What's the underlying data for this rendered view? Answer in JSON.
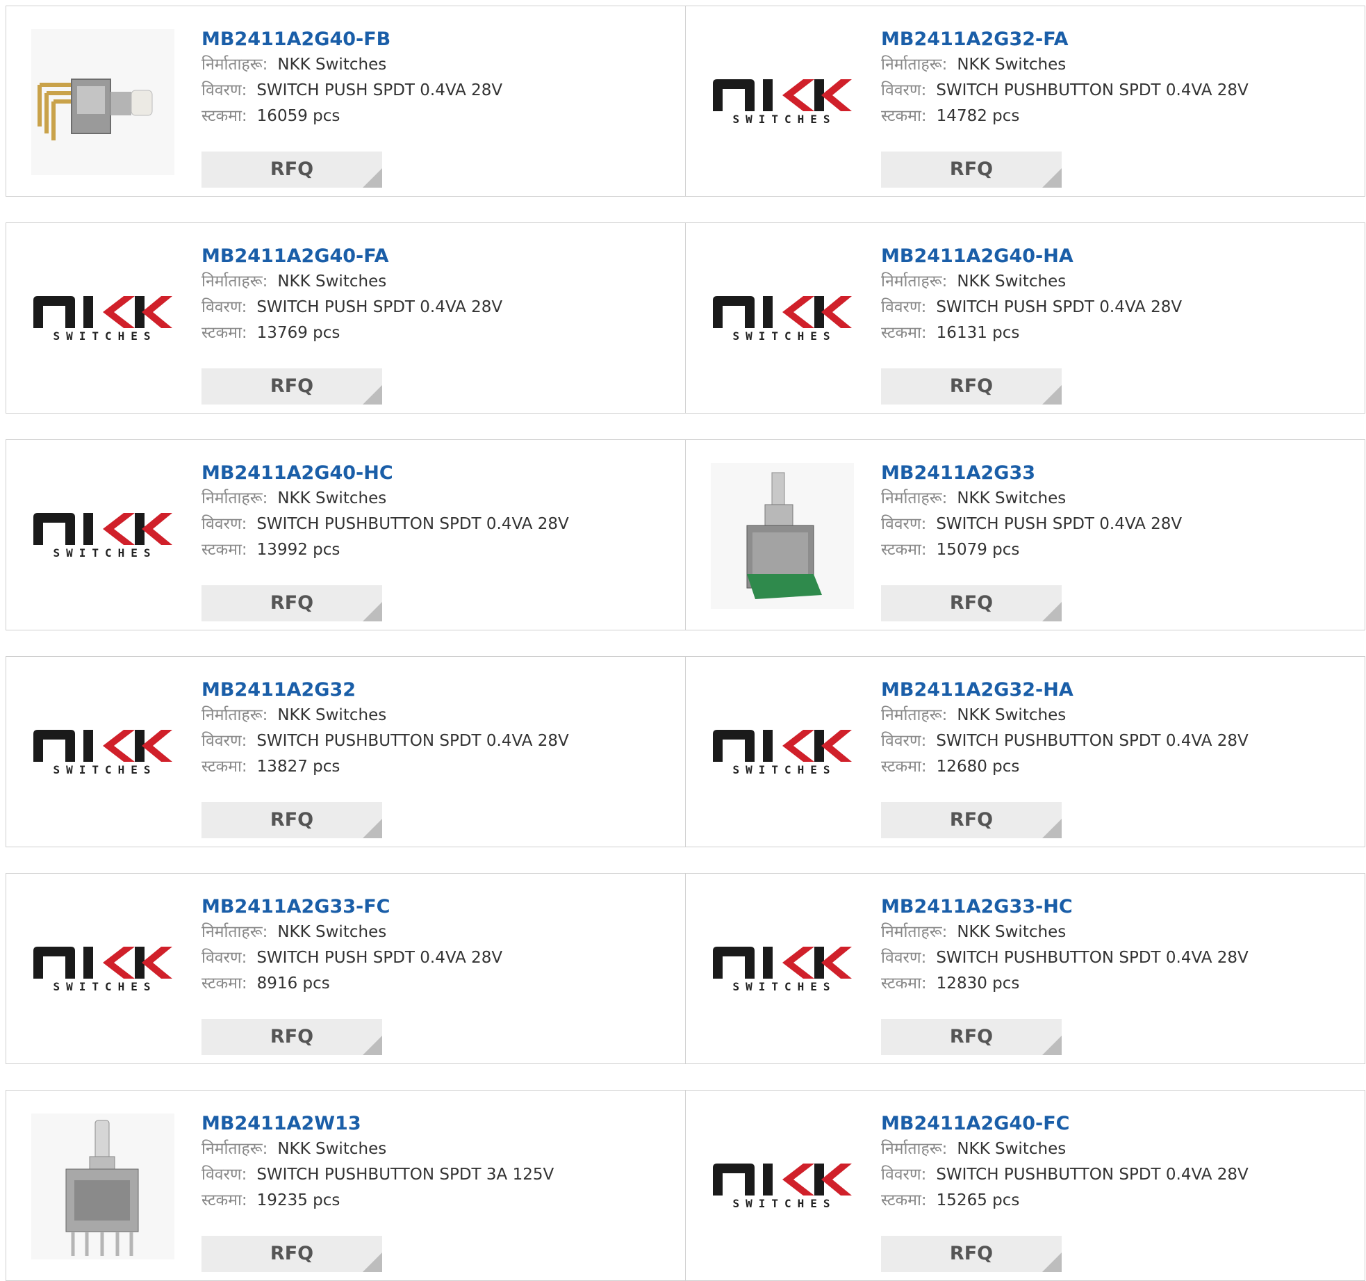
{
  "labels": {
    "manufacturer": "निर्माताहरू:",
    "description": "विवरण:",
    "stock": "स्टकमा:",
    "rfq": "RFQ"
  },
  "logo": {
    "brand": "NKK",
    "subtitle": "SWITCHES"
  },
  "products": [
    {
      "part": "MB2411A2G40-FB",
      "manufacturer": "NKK Switches",
      "description": "SWITCH PUSH SPDT 0.4VA 28V",
      "stock": "16059 pcs",
      "image": "photo-right-angle-switch"
    },
    {
      "part": "MB2411A2G32-FA",
      "manufacturer": "NKK Switches",
      "description": "SWITCH PUSHBUTTON SPDT 0.4VA 28V",
      "stock": "14782 pcs",
      "image": "nkk-logo"
    },
    {
      "part": "MB2411A2G40-FA",
      "manufacturer": "NKK Switches",
      "description": "SWITCH PUSH SPDT 0.4VA 28V",
      "stock": "13769 pcs",
      "image": "nkk-logo"
    },
    {
      "part": "MB2411A2G40-HA",
      "manufacturer": "NKK Switches",
      "description": "SWITCH PUSH SPDT 0.4VA 28V",
      "stock": "16131 pcs",
      "image": "nkk-logo"
    },
    {
      "part": "MB2411A2G40-HC",
      "manufacturer": "NKK Switches",
      "description": "SWITCH PUSHBUTTON SPDT 0.4VA 28V",
      "stock": "13992 pcs",
      "image": "nkk-logo"
    },
    {
      "part": "MB2411A2G33",
      "manufacturer": "NKK Switches",
      "description": "SWITCH PUSH SPDT 0.4VA 28V",
      "stock": "15079 pcs",
      "image": "photo-pcb-switch"
    },
    {
      "part": "MB2411A2G32",
      "manufacturer": "NKK Switches",
      "description": "SWITCH PUSHBUTTON SPDT 0.4VA 28V",
      "stock": "13827 pcs",
      "image": "nkk-logo"
    },
    {
      "part": "MB2411A2G32-HA",
      "manufacturer": "NKK Switches",
      "description": "SWITCH PUSHBUTTON SPDT 0.4VA 28V",
      "stock": "12680 pcs",
      "image": "nkk-logo"
    },
    {
      "part": "MB2411A2G33-FC",
      "manufacturer": "NKK Switches",
      "description": "SWITCH PUSH SPDT 0.4VA 28V",
      "stock": "8916 pcs",
      "image": "nkk-logo"
    },
    {
      "part": "MB2411A2G33-HC",
      "manufacturer": "NKK Switches",
      "description": "SWITCH PUSHBUTTON SPDT 0.4VA 28V",
      "stock": "12830 pcs",
      "image": "nkk-logo"
    },
    {
      "part": "MB2411A2W13",
      "manufacturer": "NKK Switches",
      "description": "SWITCH PUSHBUTTON SPDT 3A 125V",
      "stock": "19235 pcs",
      "image": "photo-vertical-switch"
    },
    {
      "part": "MB2411A2G40-FC",
      "manufacturer": "NKK Switches",
      "description": "SWITCH PUSHBUTTON SPDT 0.4VA 28V",
      "stock": "15265 pcs",
      "image": "nkk-logo"
    }
  ],
  "colors": {
    "link": "#1a5ea8",
    "logo_dark": "#1a1a1a",
    "logo_red": "#d0202a",
    "rfq_bg": "#ececec"
  }
}
